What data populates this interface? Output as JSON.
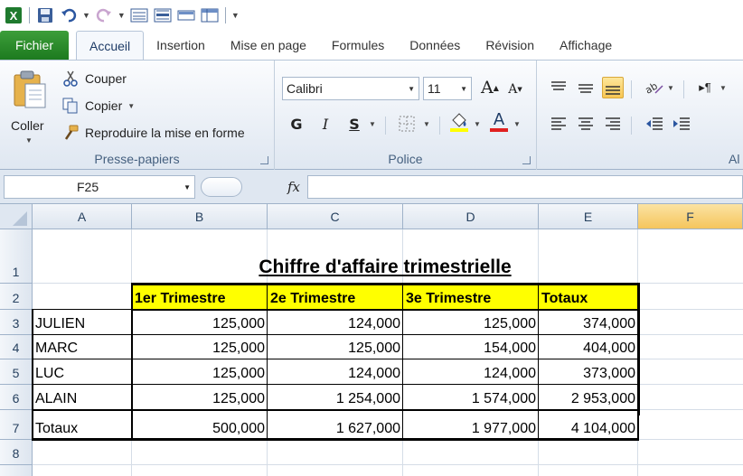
{
  "qat": {
    "icons": [
      "excel-logo",
      "save",
      "undo",
      "redo",
      "form",
      "split",
      "field",
      "table",
      "customize"
    ]
  },
  "tabs": [
    {
      "label": "Fichier"
    },
    {
      "label": "Accueil"
    },
    {
      "label": "Insertion"
    },
    {
      "label": "Mise en page"
    },
    {
      "label": "Formules"
    },
    {
      "label": "Données"
    },
    {
      "label": "Révision"
    },
    {
      "label": "Affichage"
    }
  ],
  "clipboard": {
    "paste_label": "Coller",
    "cut_label": "Couper",
    "copy_label": "Copier",
    "format_painter_label": "Reproduire la mise en forme",
    "group_label": "Presse-papiers"
  },
  "font": {
    "name": "Calibri",
    "size": "11",
    "bold": "G",
    "italic": "I",
    "underline": "S",
    "font_color_letter": "A",
    "group_label": "Police"
  },
  "alignment": {
    "group_label_partial": "Al"
  },
  "formula_bar": {
    "name_box": "F25",
    "fx": "fx",
    "formula": ""
  },
  "grid": {
    "columns": [
      "A",
      "B",
      "C",
      "D",
      "E",
      "F"
    ],
    "rows": [
      "1",
      "2",
      "3",
      "4",
      "5",
      "6",
      "7",
      "8"
    ],
    "selected_column": "F"
  },
  "sheet": {
    "title": "Chiffre d'affaire trimestrielle",
    "headers": [
      "1er  Trimestre",
      "2e  Trimestre",
      "3e  Trimestre",
      "Totaux"
    ],
    "rows": [
      {
        "name": "JULIEN",
        "values": [
          "125,000",
          "124,000",
          "125,000",
          "374,000"
        ]
      },
      {
        "name": "MARC",
        "values": [
          "125,000",
          "125,000",
          "154,000",
          "404,000"
        ]
      },
      {
        "name": "LUC",
        "values": [
          "125,000",
          "124,000",
          "124,000",
          "373,000"
        ]
      },
      {
        "name": "ALAIN",
        "values": [
          "125,000",
          "1 254,000",
          "1 574,000",
          "2 953,000"
        ]
      },
      {
        "name": "Totaux",
        "values": [
          "500,000",
          "1 627,000",
          "1 977,000",
          "4 104,000"
        ]
      }
    ]
  },
  "colors": {
    "header_fill": "#ffff00",
    "file_tab": "#2a8a2a",
    "ribbon": "#dfe7f1",
    "selected_header": "#f5c55c"
  }
}
